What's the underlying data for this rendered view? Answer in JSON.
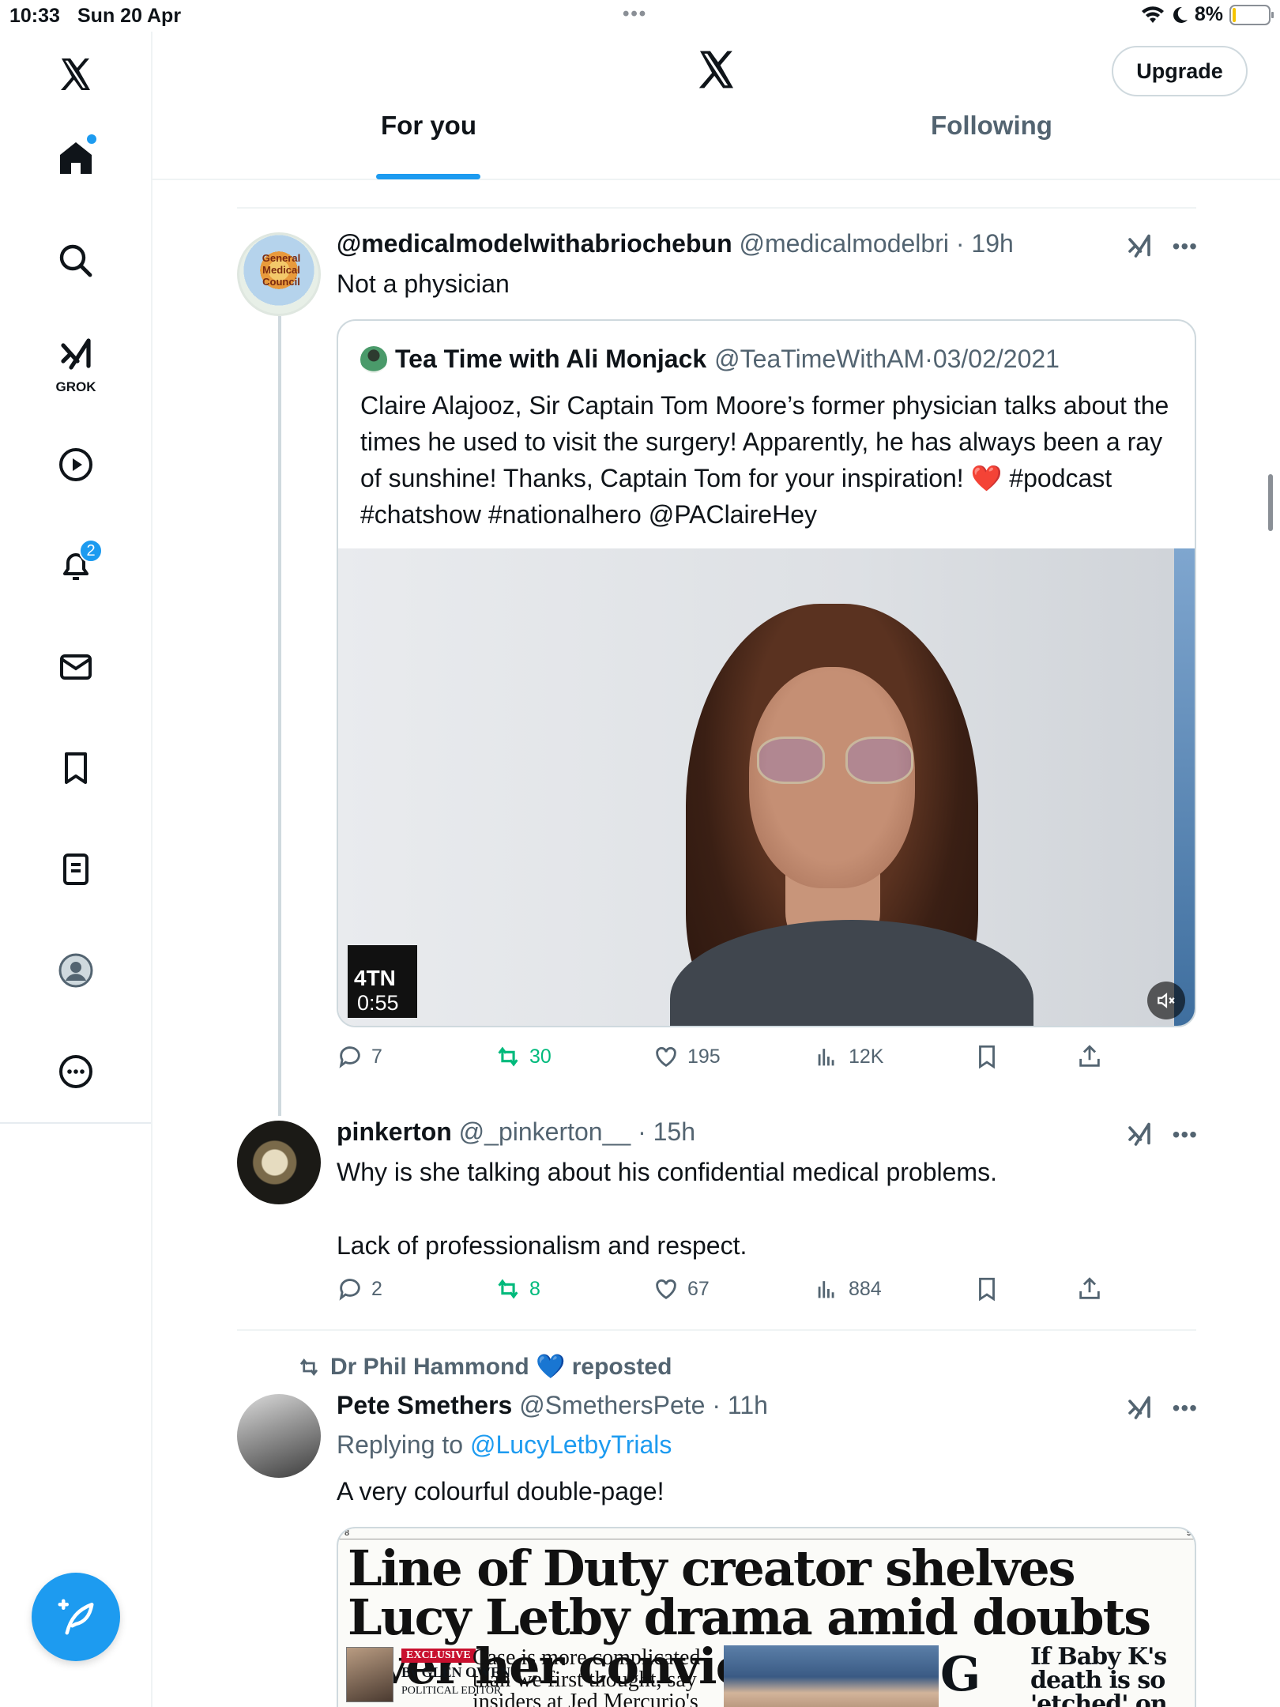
{
  "status_bar": {
    "time": "10:33",
    "date": "Sun 20 Apr",
    "battery": "8%",
    "battery_level": 0.08
  },
  "sidebar": {
    "items": [
      {
        "name": "home",
        "icon": "home-icon",
        "badge_dot": true
      },
      {
        "name": "explore",
        "icon": "search-icon"
      },
      {
        "name": "grok",
        "icon": "grok-icon",
        "label": "GROK"
      },
      {
        "name": "video",
        "icon": "play-icon"
      },
      {
        "name": "notifications",
        "icon": "bell-icon",
        "badge": "2"
      },
      {
        "name": "messages",
        "icon": "mail-icon"
      },
      {
        "name": "bookmarks",
        "icon": "bookmark-icon"
      },
      {
        "name": "lists",
        "icon": "list-icon"
      },
      {
        "name": "profile",
        "icon": "profile-icon"
      },
      {
        "name": "more",
        "icon": "more-icon"
      }
    ]
  },
  "header": {
    "upgrade_label": "Upgrade",
    "tabs": [
      {
        "label": "For you",
        "selected": true
      },
      {
        "label": "Following",
        "selected": false
      }
    ]
  },
  "tweets": [
    {
      "name": "@medicalmodelwithabriochebun",
      "handle": "@medicalmodelbri",
      "time": "19h",
      "text": "Not a physician",
      "avatar_text": "General Medical Council",
      "quote": {
        "name": "Tea Time with Ali Monjack",
        "handle": "@TeaTimeWithAM",
        "date": "03/02/2021",
        "text": "Claire Alajooz,  Sir Captain Tom Moore’s former physician talks about the times he used to visit the surgery! Apparently, he has always been a ray of sunshine! Thanks, Captain Tom for your inspiration! ❤️ #podcast #chatshow #nationalhero @PAClaireHey",
        "video_channel": "4TN",
        "video_duration": "0:55"
      },
      "stats": {
        "replies": "7",
        "reposts": "30",
        "likes": "195",
        "views": "12K"
      }
    },
    {
      "name": "pinkerton",
      "handle": "@_pinkerton__",
      "time": "15h",
      "text_line1": "Why is she talking about his confidential medical problems.",
      "text_line2": "Lack of professionalism and respect.",
      "stats": {
        "replies": "2",
        "reposts": "8",
        "likes": "67",
        "views": "884"
      }
    },
    {
      "reposted_by": "Dr Phil Hammond 💙 reposted",
      "name": "Pete Smethers",
      "handle": "@SmethersPete",
      "time": "11h",
      "replying_prefix": "Replying to ",
      "replying_to": "@LucyLetbyTrials",
      "text": "A very colourful double-page!",
      "newspaper": {
        "page_left": "8",
        "page_right": "9",
        "headline": "Line of Duty creator shelves Lucy Letby drama amid doubts over her conviction",
        "exclusive": "EXCLUSIVE",
        "byline": "By GLEN OWEN",
        "byline_role": "POLITICAL EDITOR",
        "subhead": "Case is more complicated than we first thought, say insiders at Jed Mercurio's",
        "dropcap": "G",
        "side_headline": "If Baby K's death is so 'etched' on Dr Jayaram's"
      }
    }
  ],
  "colors": {
    "accent": "#1d9bf0",
    "repost_green": "#00ba7c",
    "secondary_text": "#536471"
  }
}
